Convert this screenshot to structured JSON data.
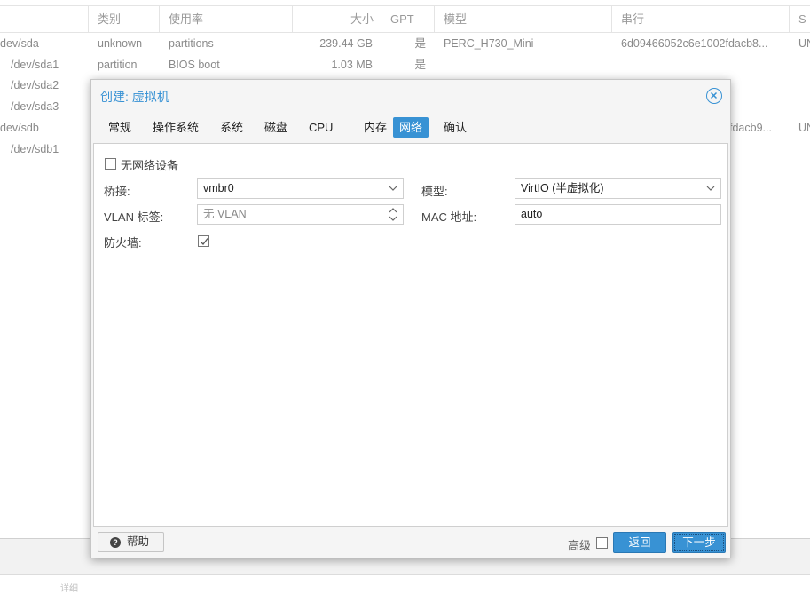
{
  "background_table": {
    "headers": [
      "",
      "类别",
      "使用率",
      "大小",
      "GPT",
      "模型",
      "串行",
      "S"
    ],
    "rows": [
      {
        "device": "dev/sda",
        "type": "unknown",
        "usage": "partitions",
        "size": "239.44 GB",
        "gpt": "是",
        "model": "PERC_H730_Mini",
        "serial": "6d09466052c6e1002fdacb8...",
        "s": "UN"
      },
      {
        "device": "/dev/sda1",
        "type": "partition",
        "usage": "BIOS boot",
        "size": "1.03 MB",
        "gpt": "是",
        "model": "",
        "serial": "",
        "s": ""
      },
      {
        "device": "/dev/sda2",
        "type": "",
        "usage": "",
        "size": "",
        "gpt": "",
        "model": "",
        "serial": "",
        "s": ""
      },
      {
        "device": "/dev/sda3",
        "type": "",
        "usage": "",
        "size": "",
        "gpt": "",
        "model": "",
        "serial": "",
        "s": ""
      },
      {
        "device": "dev/sdb",
        "type": "",
        "usage": "",
        "size": "",
        "gpt": "",
        "model": "",
        "serial": "fdacb9...",
        "s": "UN"
      },
      {
        "device": "/dev/sdb1",
        "type": "",
        "usage": "",
        "size": "",
        "gpt": "",
        "model": "",
        "serial": "",
        "s": ""
      }
    ],
    "bottom_tab_label": "详细"
  },
  "dialog": {
    "title": "创建: 虚拟机",
    "close_icon": "close-circle-icon",
    "tabs": [
      {
        "label": "常规",
        "active": false
      },
      {
        "label": "操作系统",
        "active": false
      },
      {
        "label": "系统",
        "active": false
      },
      {
        "label": "磁盘",
        "active": false
      },
      {
        "label": "CPU",
        "active": false
      },
      {
        "label": "内存",
        "active": false
      },
      {
        "label": "网络",
        "active": true
      },
      {
        "label": "确认",
        "active": false
      }
    ],
    "form": {
      "no_network_label": "无网络设备",
      "no_network_checked": false,
      "bridge_label": "桥接:",
      "bridge_value": "vmbr0",
      "vlan_label": "VLAN 标签:",
      "vlan_value": "无 VLAN",
      "firewall_label": "防火墙:",
      "firewall_checked": true,
      "model_label": "模型:",
      "model_value": "VirtIO (半虚拟化)",
      "mac_label": "MAC 地址:",
      "mac_value": "auto"
    },
    "footer": {
      "help_label": "帮助",
      "advanced_label": "高级",
      "advanced_checked": false,
      "back_label": "返回",
      "next_label": "下一步"
    },
    "accent_color": "#3892d4"
  }
}
